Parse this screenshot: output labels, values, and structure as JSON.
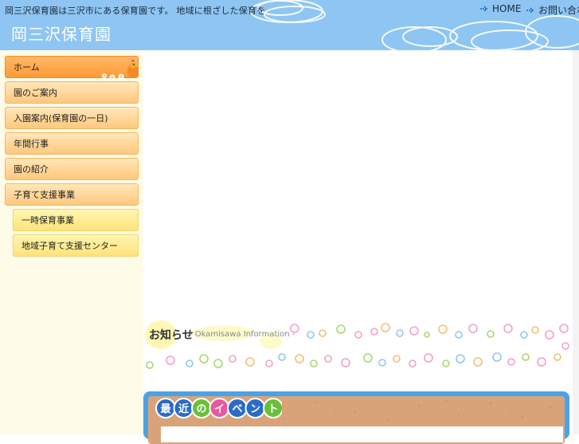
{
  "header": {
    "tagline": "岡三沢保育園は三沢市にある保育園です。 地域に根ざした保育を",
    "site_title": "岡三沢保育園",
    "links": [
      {
        "label": "HOME"
      },
      {
        "label": "お問い合わせ"
      }
    ]
  },
  "sidebar": {
    "items": [
      {
        "label": "ホーム"
      },
      {
        "label": "園のご案内"
      },
      {
        "label": "入園案内(保育園の一日)"
      },
      {
        "label": "年間行事"
      },
      {
        "label": "園の紹介"
      },
      {
        "label": "子育て支援事業"
      }
    ],
    "subitems": [
      {
        "label": "一時保育事業"
      },
      {
        "label": "地域子育て支援センター"
      }
    ]
  },
  "info": {
    "title": "お知らせ",
    "subtitle": "- Okamisawa Information -"
  },
  "events": {
    "badge_chars": [
      "最",
      "近",
      "の",
      "イ",
      "ベ",
      "ン",
      "ト"
    ],
    "badge_colors": [
      "#2a6cc7",
      "#2a6cc7",
      "#6abf3a",
      "#e75aa0",
      "#2a6cc7",
      "#2a6cc7",
      "#6abf3a"
    ]
  },
  "colors": {
    "header_bg": "#8ec5f2",
    "nav_active": "#ff9a35",
    "events_frame": "#4aa3e6"
  }
}
